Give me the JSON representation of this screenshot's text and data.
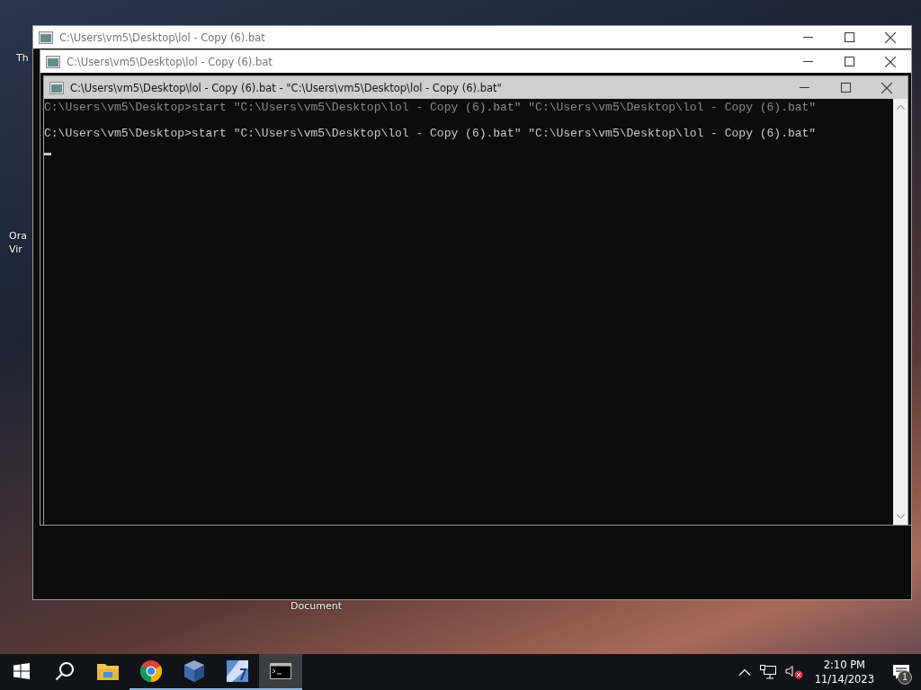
{
  "desktop": {
    "labels": [
      "Th",
      "Ora",
      "Vir",
      "Document"
    ]
  },
  "windows": [
    {
      "title": "C:\\Users\\vm5\\Desktop\\lol - Copy (6).bat",
      "active": false
    },
    {
      "title": "C:\\Users\\vm5\\Desktop\\lol - Copy (6).bat",
      "active": false
    },
    {
      "title": "C:\\Users\\vm5\\Desktop\\lol - Copy (6).bat - \"C:\\Users\\vm5\\Desktop\\lol - Copy (6).bat\"",
      "active": true,
      "lines": [
        "C:\\Users\\vm5\\Desktop>start \"C:\\Users\\vm5\\Desktop\\lol - Copy (6).bat\" \"C:\\Users\\vm5\\Desktop\\lol - Copy (6).bat\"",
        "C:\\Users\\vm5\\Desktop>start \"C:\\Users\\vm5\\Desktop\\lol - Copy (6).bat\" \"C:\\Users\\vm5\\Desktop\\lol - Copy (6).bat\""
      ]
    }
  ],
  "taskbar": {
    "items": [
      {
        "kind": "explorer",
        "running": false,
        "active": false
      },
      {
        "kind": "chrome",
        "running": true,
        "active": false
      },
      {
        "kind": "virtualbox",
        "running": true,
        "active": false
      },
      {
        "kind": "app",
        "running": true,
        "active": false
      },
      {
        "kind": "console",
        "running": true,
        "active": true
      }
    ],
    "tray": {
      "volume_muted": true,
      "time": "2:10 PM",
      "date": "11/14/2023",
      "notification_count": "1"
    }
  }
}
